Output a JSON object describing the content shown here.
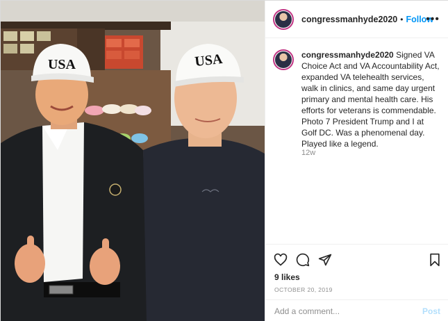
{
  "post": {
    "username": "congressmanhyde2020",
    "follow_label": "Follow",
    "separator": "•",
    "more_label": "•••"
  },
  "photo": {
    "hat_text": "USA",
    "description_icon": "photo-of-two-men-in-usa-hats"
  },
  "caption": {
    "username": "congressmanhyde2020",
    "text": "Signed VA Choice Act and VA Accountability Act, expanded VA telehealth services, walk in clinics, and same day urgent primary and mental health care. His efforts for veterans is commendable. Photo 7 President Trump and I at Golf DC. Was a phenomenal day. Played like a legend.",
    "age": "12w"
  },
  "actions": {
    "like_icon": "heart-icon",
    "comment_icon": "comment-icon",
    "share_icon": "share-icon",
    "save_icon": "bookmark-icon"
  },
  "likes": "9 likes",
  "date": "OCTOBER 20, 2019",
  "comment": {
    "placeholder": "Add a comment...",
    "post_label": "Post"
  },
  "colors": {
    "accent": "#0095f6",
    "post_disabled": "#b2dffc",
    "muted": "#8e8e8e",
    "border": "#efefef"
  }
}
